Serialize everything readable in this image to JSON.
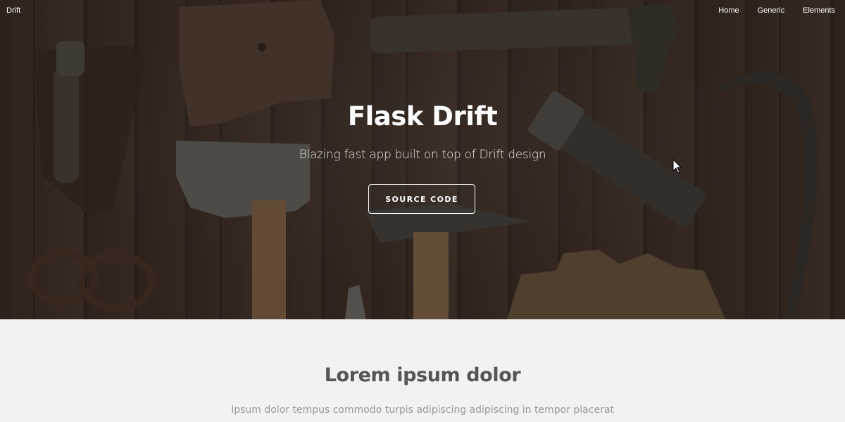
{
  "header": {
    "brand": "Drift",
    "nav": [
      "Home",
      "Generic",
      "Elements"
    ]
  },
  "hero": {
    "title": "Flask Drift",
    "subtitle": "Blazing fast app built on top of Drift design",
    "button": "SOURCE CODE"
  },
  "section": {
    "title": "Lorem ipsum dolor",
    "text": "Ipsum dolor tempus commodo turpis adipiscing adipiscing in tempor placerat"
  }
}
